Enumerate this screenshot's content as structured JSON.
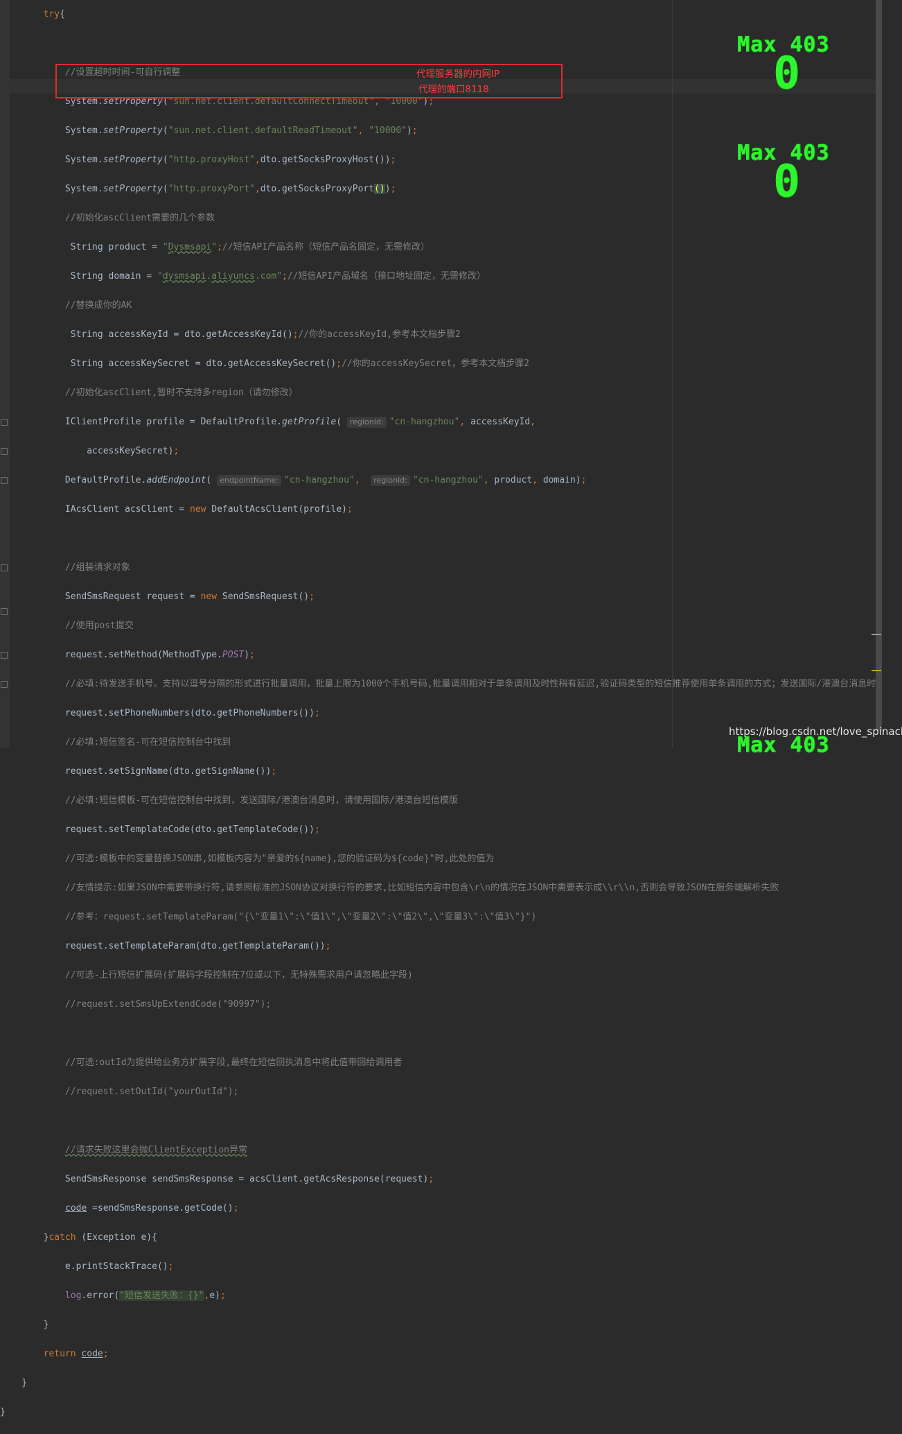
{
  "editor": {
    "annotations": {
      "proxy_host": "代理服务器的内网IP",
      "proxy_port": "代理的端口8118"
    },
    "overlay": {
      "title": "Max  403",
      "value": "0"
    },
    "watermark": "https://blog.csdn.net/love_spinach",
    "colors": {
      "background": "#2b2b2b",
      "keyword": "#cc7832",
      "string": "#6a8759",
      "comment": "#808080",
      "annotation_box": "#e02b2b",
      "overlay_green": "#2ef52e"
    }
  }
}
